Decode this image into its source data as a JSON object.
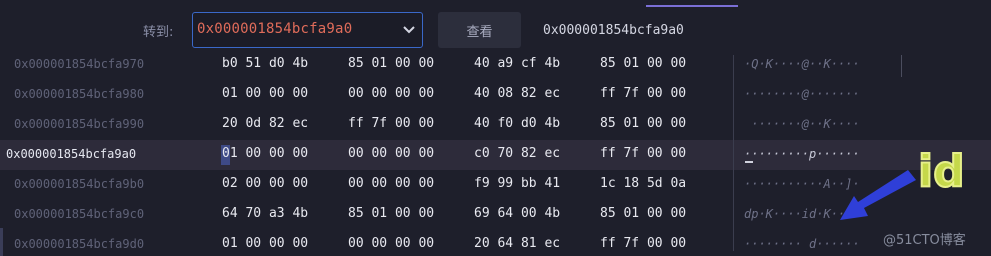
{
  "toolbar": {
    "goto_label": "转到:",
    "address_value": "0x000001854bcfa9a0",
    "view_button": "查看",
    "current_address": "0x000001854bcfa9a0"
  },
  "rows": [
    {
      "address": "0x000001854bcfa970",
      "groups": [
        "b0 51 d0 4b",
        "85 01 00 00",
        "40 a9 cf 4b",
        "85 01 00 00"
      ],
      "ascii": "·Q·K····@··K····"
    },
    {
      "address": "0x000001854bcfa980",
      "groups": [
        "01 00 00 00",
        "00 00 00 00",
        "40 08 82 ec",
        "ff 7f 00 00"
      ],
      "ascii": "········@·······"
    },
    {
      "address": "0x000001854bcfa990",
      "groups": [
        "20 0d 82 ec",
        "ff 7f 00 00",
        "40 f0 d0 4b",
        "85 01 00 00"
      ],
      "ascii": " ·······@··K····"
    },
    {
      "address": "0x000001854bcfa9a0",
      "groups": [
        "01 00 00 00",
        "00 00 00 00",
        "c0 70 82 ec",
        "ff 7f 00 00"
      ],
      "ascii": "·········p······",
      "selected": true
    },
    {
      "address": "0x000001854bcfa9b0",
      "groups": [
        "02 00 00 00",
        "00 00 00 00",
        "f9 99 bb 41",
        "1c 18 5d 0a"
      ],
      "ascii": "···········A··]·"
    },
    {
      "address": "0x000001854bcfa9c0",
      "groups": [
        "64 70 a3 4b",
        "85 01 00 00",
        "69 64 00 4b",
        "85 01 00 00"
      ],
      "ascii": "dp·K····id·K····"
    },
    {
      "address": "0x000001854bcfa9d0",
      "groups": [
        "01 00 00 00",
        "00 00 00 00",
        "20 64 81 ec",
        "ff 7f 00 00"
      ],
      "ascii": "········ d······"
    }
  ],
  "annotation": {
    "label": "id",
    "label_color": "#c5d84a",
    "arrow_color": "#2f3fd8"
  },
  "watermark": "@51CTO博客",
  "colors": {
    "background": "#1e1f2b",
    "address_input_text": "#e06c5a",
    "input_border": "#3a68c8",
    "selected_row": "#2d2b3a",
    "tab_accent": "#7b6fd6"
  }
}
